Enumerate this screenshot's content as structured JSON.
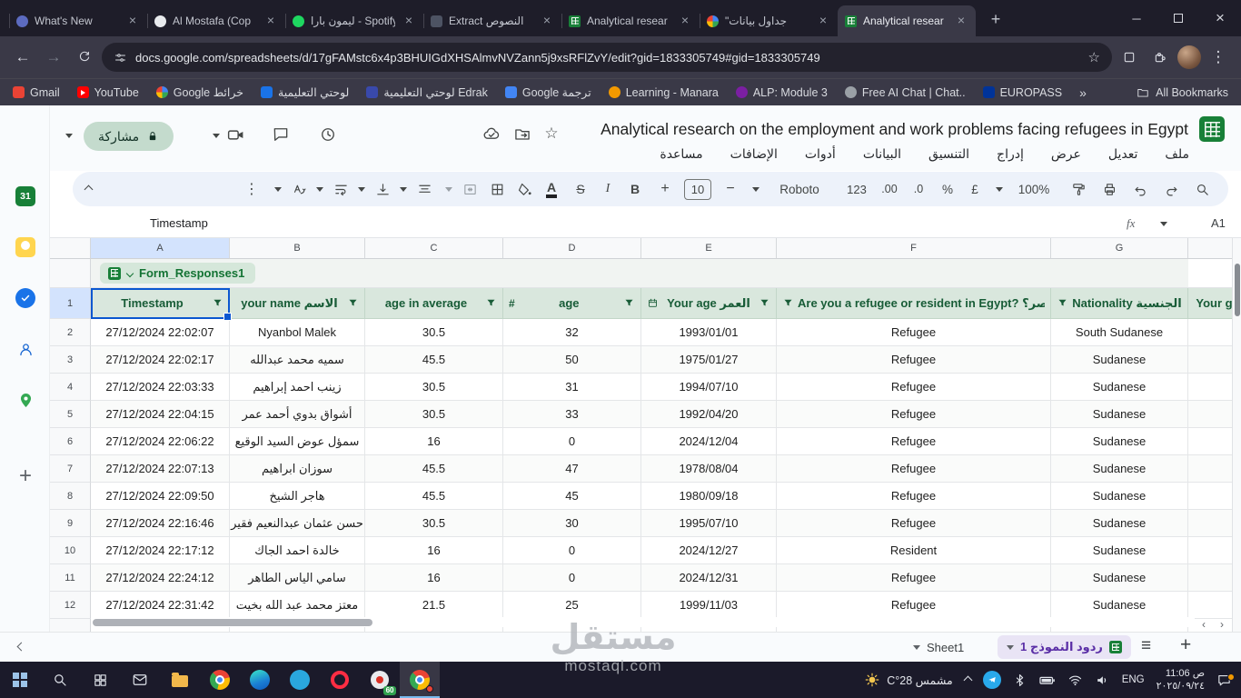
{
  "icons": {
    "close": "×",
    "plus": "+",
    "minus": "−",
    "more_vertical": "⋮",
    "star_outline": "☆",
    "back_arrow": "←",
    "forward_arrow": "→",
    "overflow_chevrons": "»",
    "hamburger": "≡",
    "hash": "#",
    "bold": "B",
    "italic": "I",
    "strikethrough": "S",
    "text_color": "A",
    "minimize": "─",
    "scroll_left": "‹",
    "scroll_right": "›"
  },
  "browser": {
    "tabs": [
      {
        "title": "What's New"
      },
      {
        "title": "Al Mostafa (Cop"
      },
      {
        "title": "ليمون بارا - Spotify"
      },
      {
        "title": "Extract النصوص"
      },
      {
        "title": "Analytical resear"
      },
      {
        "title": "\"جداول بيانات"
      },
      {
        "title": "Analytical resear",
        "active": true
      }
    ],
    "url": "docs.google.com/spreadsheets/d/17gFAMstc6x4p3BHUIGdXHSAlmvNVZann5j9xsRFlZvY/edit?gid=1833305749#gid=1833305749",
    "bookmarks": [
      "Gmail",
      "YouTube",
      "Google خرائط",
      "لوحتي التعليمية",
      "لوحتي التعليمية Edrak",
      "Google ترجمة",
      "Learning - Manara",
      "ALP: Module 3",
      "Free AI Chat | Chat..",
      "EUROPASS"
    ],
    "all_bookmarks_label": "All Bookmarks"
  },
  "sheets": {
    "doc_title": "Analytical research on the employment and work problems facing refugees in Egypt",
    "menus": [
      "ملف",
      "تعديل",
      "عرض",
      "إدراج",
      "التنسيق",
      "البيانات",
      "أدوات",
      "الإضافات",
      "مساعدة"
    ],
    "share_label": "مشاركة",
    "toolbar": {
      "zoom": "100%",
      "currency": "£",
      "percent": "%",
      "dec_more": ".0",
      "dec_less": ".00",
      "number_format": "123",
      "font": "Roboto",
      "font_size": "10"
    },
    "formula": {
      "name_box": "A1",
      "fx": "fx",
      "content": "Timestamp"
    },
    "side_panel": {
      "calendar_day": "31"
    }
  },
  "grid": {
    "column_letters": [
      "A",
      "B",
      "C",
      "D",
      "E",
      "F",
      "G"
    ],
    "row1_number": "1",
    "table_name": "Form_Responses1",
    "headers": [
      "Timestamp",
      "your name الاسم",
      "age in average",
      "age",
      "Your age العمر",
      "Are you a refugee or resident in Egypt? هل أنت لاجئ أو مقيم في مصر؟",
      "Nationality الجنسية",
      "Your g"
    ],
    "rows": [
      {
        "n": "2",
        "cells": [
          "27/12/2024 22:02:07",
          "Nyanbol Malek",
          "30.5",
          "32",
          "1993/01/01",
          "Refugee",
          "South Sudanese"
        ]
      },
      {
        "n": "3",
        "cells": [
          "27/12/2024 22:02:17",
          "سميه محمد عبدالله",
          "45.5",
          "50",
          "1975/01/27",
          "Refugee",
          "Sudanese"
        ]
      },
      {
        "n": "4",
        "cells": [
          "27/12/2024 22:03:33",
          "زينب احمد إبراهيم",
          "30.5",
          "31",
          "1994/07/10",
          "Refugee",
          "Sudanese"
        ]
      },
      {
        "n": "5",
        "cells": [
          "27/12/2024 22:04:15",
          "أشواق بدوي أحمد عمر",
          "30.5",
          "33",
          "1992/04/20",
          "Refugee",
          "Sudanese"
        ]
      },
      {
        "n": "6",
        "cells": [
          "27/12/2024 22:06:22",
          "سمؤل عوض السيد الوقيع",
          "16",
          "0",
          "2024/12/04",
          "Refugee",
          "Sudanese"
        ]
      },
      {
        "n": "7",
        "cells": [
          "27/12/2024 22:07:13",
          "سوزان ابراهيم",
          "45.5",
          "47",
          "1978/08/04",
          "Refugee",
          "Sudanese"
        ]
      },
      {
        "n": "8",
        "cells": [
          "27/12/2024 22:09:50",
          "هاجر الشيخ",
          "45.5",
          "45",
          "1980/09/18",
          "Refugee",
          "Sudanese"
        ]
      },
      {
        "n": "9",
        "cells": [
          "27/12/2024 22:16:46",
          "حسن عثمان عبدالنعيم فقير",
          "30.5",
          "30",
          "1995/07/10",
          "Refugee",
          "Sudanese"
        ]
      },
      {
        "n": "10",
        "cells": [
          "27/12/2024 22:17:12",
          "خالدة احمد الجاك",
          "16",
          "0",
          "2024/12/27",
          "Resident",
          "Sudanese"
        ]
      },
      {
        "n": "11",
        "cells": [
          "27/12/2024 22:24:12",
          "سامي الياس الطاهر",
          "16",
          "0",
          "2024/12/31",
          "Refugee",
          "Sudanese"
        ]
      },
      {
        "n": "12",
        "cells": [
          "27/12/2024 22:31:42",
          "معتز محمد عبد الله بخيت",
          "21.5",
          "25",
          "1999/11/03",
          "Refugee",
          "Sudanese"
        ]
      }
    ]
  },
  "footer": {
    "tabs": [
      {
        "label": "Sheet1"
      },
      {
        "label": "ردود النموذج 1",
        "active": true
      }
    ]
  },
  "watermark": {
    "line1": "مستقل",
    "line2": "mostaql.com"
  },
  "taskbar": {
    "weather": "مشمس 28°C",
    "badge": "60",
    "language": "ENG",
    "time": "11:06 ص",
    "date": "٢٠٢٥/٠٩/٢٤"
  },
  "colors": {
    "selection_blue": "#0b57d0",
    "table_green": "#188038",
    "header_green_bg": "#d9e7dd",
    "header_green_text": "#185c37",
    "active_sheet_tab_text": "#5a2ea6",
    "share_pill_bg": "#c4dbcd"
  }
}
